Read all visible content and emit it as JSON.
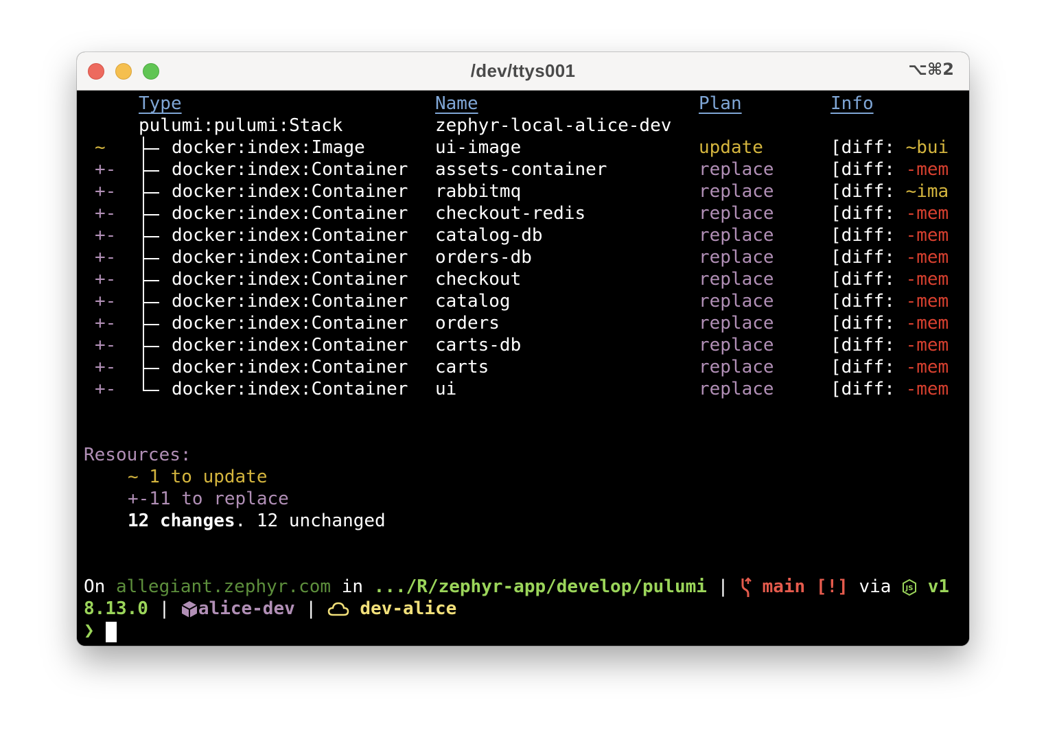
{
  "window": {
    "title": "/dev/ttys001",
    "shortcut": "⌥⌘2",
    "buttons": {
      "close": "close",
      "minimize": "minimize",
      "maximize": "maximize"
    }
  },
  "table": {
    "headers": {
      "type": "Type",
      "name": "Name",
      "plan": "Plan",
      "info": "Info"
    },
    "stack": {
      "type": "pulumi:pulumi:Stack",
      "name": "zephyr-local-alice-dev"
    },
    "rows": [
      {
        "op": "~",
        "type": "docker:index:Image",
        "name": "ui-image",
        "plan": "update",
        "info_prefix": "[diff: ",
        "info_value": "~bui",
        "info_kind": "update"
      },
      {
        "op": "+-",
        "type": "docker:index:Container",
        "name": "assets-container",
        "plan": "replace",
        "info_prefix": "[diff: ",
        "info_value": "-mem",
        "info_kind": "delete"
      },
      {
        "op": "+-",
        "type": "docker:index:Container",
        "name": "rabbitmq",
        "plan": "replace",
        "info_prefix": "[diff: ",
        "info_value": "~ima",
        "info_kind": "update"
      },
      {
        "op": "+-",
        "type": "docker:index:Container",
        "name": "checkout-redis",
        "plan": "replace",
        "info_prefix": "[diff: ",
        "info_value": "-mem",
        "info_kind": "delete"
      },
      {
        "op": "+-",
        "type": "docker:index:Container",
        "name": "catalog-db",
        "plan": "replace",
        "info_prefix": "[diff: ",
        "info_value": "-mem",
        "info_kind": "delete"
      },
      {
        "op": "+-",
        "type": "docker:index:Container",
        "name": "orders-db",
        "plan": "replace",
        "info_prefix": "[diff: ",
        "info_value": "-mem",
        "info_kind": "delete"
      },
      {
        "op": "+-",
        "type": "docker:index:Container",
        "name": "checkout",
        "plan": "replace",
        "info_prefix": "[diff: ",
        "info_value": "-mem",
        "info_kind": "delete"
      },
      {
        "op": "+-",
        "type": "docker:index:Container",
        "name": "catalog",
        "plan": "replace",
        "info_prefix": "[diff: ",
        "info_value": "-mem",
        "info_kind": "delete"
      },
      {
        "op": "+-",
        "type": "docker:index:Container",
        "name": "orders",
        "plan": "replace",
        "info_prefix": "[diff: ",
        "info_value": "-mem",
        "info_kind": "delete"
      },
      {
        "op": "+-",
        "type": "docker:index:Container",
        "name": "carts-db",
        "plan": "replace",
        "info_prefix": "[diff: ",
        "info_value": "-mem",
        "info_kind": "delete"
      },
      {
        "op": "+-",
        "type": "docker:index:Container",
        "name": "carts",
        "plan": "replace",
        "info_prefix": "[diff: ",
        "info_value": "-mem",
        "info_kind": "delete"
      },
      {
        "op": "+-",
        "type": "docker:index:Container",
        "name": "ui",
        "plan": "replace",
        "info_prefix": "[diff: ",
        "info_value": "-mem",
        "info_kind": "delete"
      }
    ]
  },
  "summary": {
    "heading": "Resources:",
    "update_line": "~ 1 to update",
    "replace_line": "+-11 to replace",
    "changes_count": "12 changes",
    "unchanged": ". 12 unchanged"
  },
  "prompt": {
    "on_label": "On ",
    "host": "allegiant.zephyr.com",
    "in_label": " in ",
    "path": ".../R/zephyr-app/develop/pulumi",
    "sep1": " | ",
    "git_icon": "git-branch-icon",
    "branch": "main",
    "git_status": "[!]",
    "via_label": " via ",
    "node_icon": "nodejs-icon",
    "node_version_part1": "v1",
    "node_version_part2": "8.13.0",
    "sep2": " | ",
    "pulumi_icon": "package-cube-icon",
    "pulumi_stack": "alice-dev",
    "sep3": " | ",
    "cloud_icon": "cloud-icon",
    "cloud_profile": "dev-alice",
    "prompt_char": "❯"
  },
  "colors": {
    "background": "#000000",
    "header": "#7fa6d6",
    "update": "#d4b53e",
    "replace": "#b18fb6",
    "delete": "#d7402f",
    "host": "#5d8f3c",
    "path": "#9bd55a",
    "git": "#e55b4d",
    "cloud": "#f2e07a"
  }
}
